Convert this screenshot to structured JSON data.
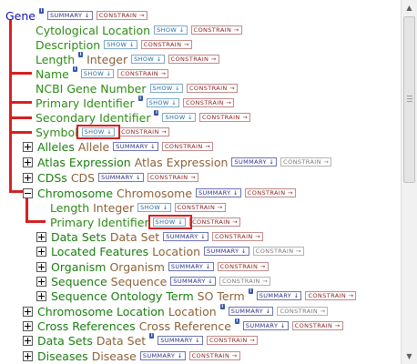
{
  "ui": {
    "summary": "SUMMARY ↓",
    "show": "SHOW ↓",
    "constrain": "CONSTRAIN →",
    "info": "i"
  },
  "scrollbar": {
    "up_arrow": "▲",
    "down_arrow": "▼"
  },
  "tree": {
    "root": "Gene",
    "fields": {
      "cytological_location": "Cytological Location",
      "description": "Description",
      "length": "Length",
      "length_type": "Integer",
      "name": "Name",
      "ncbi_gene_number": "NCBI Gene Number",
      "primary_identifier": "Primary Identifier",
      "secondary_identifier": "Secondary Identifier",
      "symbol": "Symbol"
    },
    "refs": {
      "alleles": {
        "label": "Alleles",
        "type": "Allele"
      },
      "atlas_expression": {
        "label": "Atlas Expression",
        "type": "Atlas Expression"
      },
      "cdss": {
        "label": "CDSs",
        "type": "CDS"
      },
      "chromosome": {
        "label": "Chromosome",
        "type": "Chromosome"
      },
      "chromosome_location": {
        "label": "Chromosome Location",
        "type": "Location"
      },
      "cross_references": {
        "label": "Cross References",
        "type": "Cross Reference"
      },
      "data_sets": {
        "label": "Data Sets",
        "type": "Data Set"
      },
      "diseases": {
        "label": "Diseases",
        "type": "Disease"
      }
    },
    "chromosome_children": {
      "length": "Length",
      "length_type": "Integer",
      "primary_identifier": "Primary Identifier",
      "data_sets": {
        "label": "Data Sets",
        "type": "Data Set"
      },
      "located_features": {
        "label": "Located Features",
        "type": "Location"
      },
      "organism": {
        "label": "Organism",
        "type": "Organism"
      },
      "sequence": {
        "label": "Sequence",
        "type": "Sequence"
      },
      "sequence_ontology_term": {
        "label": "Sequence Ontology Term",
        "type": "SO Term"
      }
    }
  }
}
